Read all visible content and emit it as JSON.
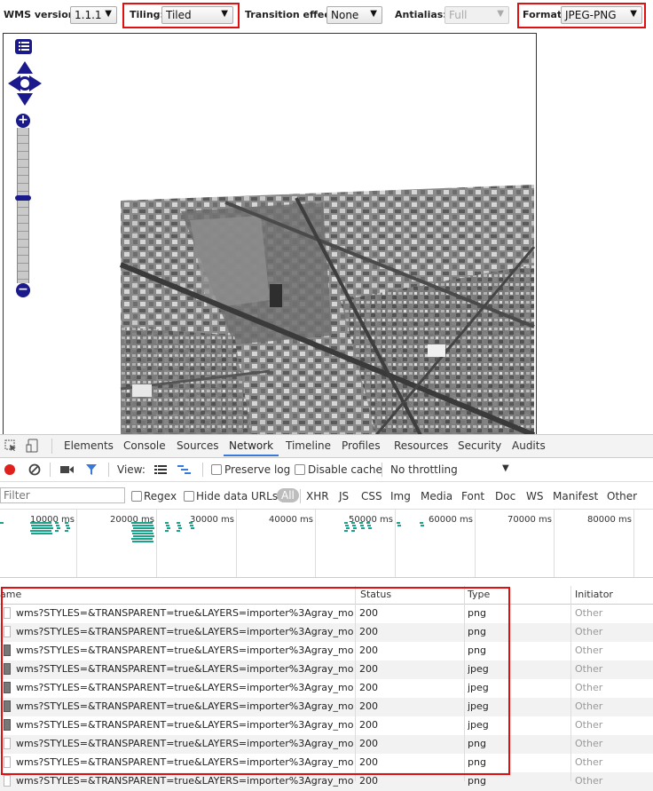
{
  "toolbar": {
    "wms_version_label": "WMS version:",
    "wms_version_value": "1.1.1",
    "tiling_label": "Tiling:",
    "tiling_value": "Tiled",
    "transition_label": "Transition effect:",
    "transition_value": "None",
    "antialias_label": "Antialias:",
    "antialias_value": "Full",
    "format_label": "Format:",
    "format_value": "JPEG-PNG"
  },
  "map": {
    "controls": {
      "layer_switcher_icon": "list-icon",
      "pan_icon": "pan-arrows-icon",
      "zoom_in_symbol": "+",
      "zoom_out_symbol": "−"
    },
    "zoom_level_fraction": 0.55
  },
  "devtools": {
    "tabs": [
      "Elements",
      "Console",
      "Sources",
      "Network",
      "Timeline",
      "Profiles",
      "Resources",
      "Security",
      "Audits"
    ],
    "active_tab": "Network",
    "view_label": "View:",
    "preserve_log_label": "Preserve log",
    "disable_cache_label": "Disable cache",
    "throttling_value": "No throttling",
    "filter_placeholder": "Filter",
    "regex_label": "Regex",
    "hide_data_urls_label": "Hide data URLs",
    "filter_types": [
      "All",
      "XHR",
      "JS",
      "CSS",
      "Img",
      "Media",
      "Font",
      "Doc",
      "WS",
      "Manifest",
      "Other"
    ],
    "timeline_ticks": [
      "10000 ms",
      "20000 ms",
      "30000 ms",
      "40000 ms",
      "50000 ms",
      "60000 ms",
      "70000 ms",
      "80000 ms"
    ],
    "columns": {
      "name": "Name",
      "status": "Status",
      "type": "Type",
      "initiator": "Initiator"
    },
    "name_visible_text": "ame",
    "rows": [
      {
        "name": "wms?STYLES=&TRANSPARENT=true&LAYERS=importer%3Agray_mosaic&...",
        "status": "200",
        "type": "png",
        "initiator": "Other"
      },
      {
        "name": "wms?STYLES=&TRANSPARENT=true&LAYERS=importer%3Agray_mosaic&...",
        "status": "200",
        "type": "png",
        "initiator": "Other"
      },
      {
        "name": "wms?STYLES=&TRANSPARENT=true&LAYERS=importer%3Agray_mosaic&...",
        "status": "200",
        "type": "png",
        "initiator": "Other"
      },
      {
        "name": "wms?STYLES=&TRANSPARENT=true&LAYERS=importer%3Agray_mosaic&...",
        "status": "200",
        "type": "jpeg",
        "initiator": "Other"
      },
      {
        "name": "wms?STYLES=&TRANSPARENT=true&LAYERS=importer%3Agray_mosaic&...",
        "status": "200",
        "type": "jpeg",
        "initiator": "Other"
      },
      {
        "name": "wms?STYLES=&TRANSPARENT=true&LAYERS=importer%3Agray_mosaic&...",
        "status": "200",
        "type": "jpeg",
        "initiator": "Other"
      },
      {
        "name": "wms?STYLES=&TRANSPARENT=true&LAYERS=importer%3Agray_mosaic&...",
        "status": "200",
        "type": "jpeg",
        "initiator": "Other"
      },
      {
        "name": "wms?STYLES=&TRANSPARENT=true&LAYERS=importer%3Agray_mosaic&...",
        "status": "200",
        "type": "png",
        "initiator": "Other"
      },
      {
        "name": "wms?STYLES=&TRANSPARENT=true&LAYERS=importer%3Agray_mosaic&...",
        "status": "200",
        "type": "png",
        "initiator": "Other"
      },
      {
        "name": "wms?STYLES=&TRANSPARENT=true&LAYERS=importer%3Agray_mosaic&...",
        "status": "200",
        "type": "png",
        "initiator": "Other"
      }
    ]
  },
  "colors": {
    "highlight": "#e01010",
    "map_control": "#1a1a8c",
    "timeline_bar": "#1aa38a",
    "active_tab": "#3879d9"
  }
}
